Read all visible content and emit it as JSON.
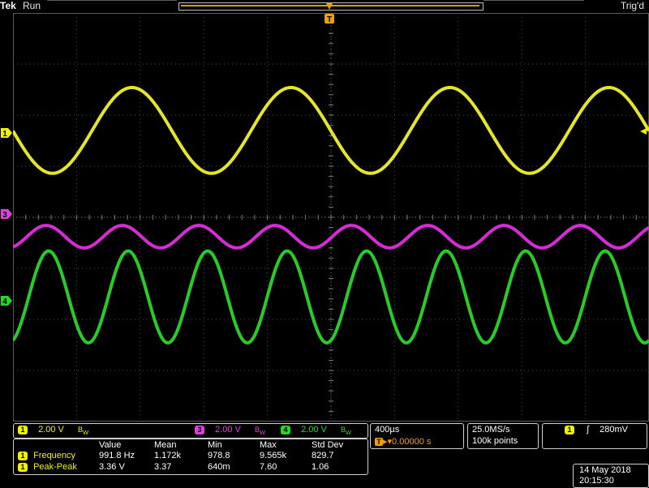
{
  "topbar": {
    "brand": "Tek",
    "run_state": "Run",
    "trigger_status": "Trig'd"
  },
  "markers": {
    "trigger_top": "T",
    "ch1_label": "1",
    "ch3_label": "3",
    "ch4_label": "4"
  },
  "channels": [
    {
      "id": "1",
      "scale": "2.00 V",
      "bw": "ᴮᵥᶜ",
      "color": "#f2f200"
    },
    {
      "id": "3",
      "scale": "2.00 V",
      "bw": "ᴮᵥᶜ",
      "color": "#e040e0"
    },
    {
      "id": "4",
      "scale": "2.00 V",
      "bw": "ᴮᵥᶜ",
      "color": "#28d828"
    }
  ],
  "timebase": {
    "scale": "400µs",
    "position": "0.00000 s"
  },
  "acquisition": {
    "sample_rate": "25.0MS/s",
    "record_length": "100k points"
  },
  "trigger": {
    "source": "1",
    "slope": "rising",
    "level": "280mV"
  },
  "measurements": {
    "headers": [
      "Value",
      "Mean",
      "Min",
      "Max",
      "Std Dev"
    ],
    "rows": [
      {
        "source": "1",
        "name": "Frequency",
        "value": "991.8 Hz",
        "mean": "1.172k",
        "min": "978.8",
        "max": "9.565k",
        "std": "829.7"
      },
      {
        "source": "1",
        "name": "Peak-Peak",
        "value": "3.36 V",
        "mean": "3.37",
        "min": "640m",
        "max": "7.60",
        "std": "1.06"
      }
    ]
  },
  "datetime": {
    "date": "14 May 2018",
    "time": "20:15:30"
  },
  "waveforms": [
    {
      "channel": "1",
      "color": "#e6e628",
      "period_div": 2.5,
      "amplitude_div": 0.84,
      "offset_div": 1.7,
      "phase_div": 1.87,
      "stroke": 4
    },
    {
      "channel": "3",
      "color": "#d82ad8",
      "period_div": 1.2,
      "amplitude_div": 0.22,
      "offset_div": -0.38,
      "phase_div": 0.52,
      "stroke": 4
    },
    {
      "channel": "4",
      "color": "#28cc28",
      "period_div": 1.25,
      "amplitude_div": 0.9,
      "offset_div": -1.56,
      "phase_div": 0.56,
      "stroke": 4
    }
  ]
}
